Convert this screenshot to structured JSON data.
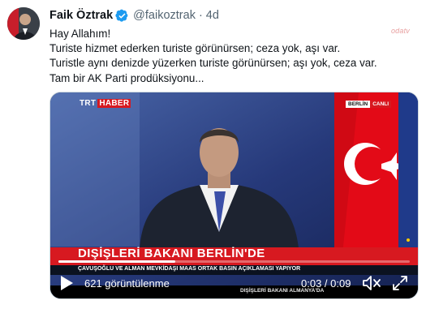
{
  "author": {
    "name": "Faik Öztrak",
    "handle": "@faikoztrak",
    "separator": "·",
    "time": "4d"
  },
  "tweet": {
    "lines": [
      "Hay Allahım!",
      "Turiste hizmet ederken turiste görünürsen; ceza yok, aşı var.",
      "Turistle aynı denizde yüzerken turiste görünürsen; aşı yok, ceza var.",
      "Tam bir AK Parti prodüksiyonu..."
    ]
  },
  "watermark": "odatv",
  "video": {
    "channel_logo": "TRT",
    "channel_logo_suffix": "HABER",
    "location_badge": "BERLİN",
    "live_badge": "CANLI",
    "headline": "DIŞİŞLERİ BAKANI BERLİN'DE",
    "subline": "ÇAVUŞOĞLU VE ALMAN MEVKİDAŞI MAAS ORTAK BASIN AÇIKLAMASI YAPIYOR",
    "ticker": "DIŞİŞLERİ BAKANI ALMANYA'DA",
    "views": "621 görüntülenme",
    "timecode": "0:03 / 0:09",
    "progress": 0.333
  },
  "icons": {
    "verified": "verified-badge-icon",
    "play": "play-icon",
    "volume": "volume-muted-icon",
    "fullscreen": "fullscreen-icon"
  },
  "colors": {
    "verified_blue": "#1d9bf0",
    "text_primary": "#0f1419",
    "text_secondary": "#536471",
    "trt_red": "#d71920"
  }
}
